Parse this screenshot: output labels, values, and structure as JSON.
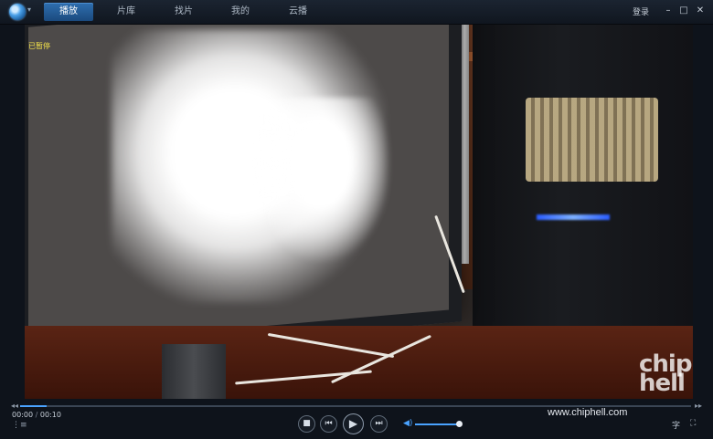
{
  "window": {
    "menu_caret": "▾",
    "tabs": [
      {
        "label": "播放",
        "active": true
      },
      {
        "label": "片库",
        "active": false
      },
      {
        "label": "找片",
        "active": false
      },
      {
        "label": "我的",
        "active": false
      },
      {
        "label": "云播",
        "active": false
      }
    ],
    "login_label": "登录",
    "controls": {
      "minimize": "–",
      "maximize": "□",
      "close": "✕"
    }
  },
  "video": {
    "status_text": "已暂停",
    "watermark_logo": "chip hell",
    "watermark_site": "www.chiphell.com"
  },
  "player": {
    "current_time": "00:00",
    "separator": "/",
    "duration": "00:10",
    "progress_fraction": 0.04,
    "volume_fraction": 1.0,
    "seek_back_icon": "◂◂",
    "seek_forward_icon": "▸▸",
    "playlist_icon": "⋮≡",
    "stop_icon": "■",
    "prev_icon": "⏮",
    "play_icon": "▶",
    "next_icon": "⏭",
    "volume_icon": "◀)",
    "subtitle_label": "字",
    "fullscreen_icon": "⛶"
  },
  "colors": {
    "accent": "#4aa3ff",
    "status_yellow": "#f3e24a"
  }
}
